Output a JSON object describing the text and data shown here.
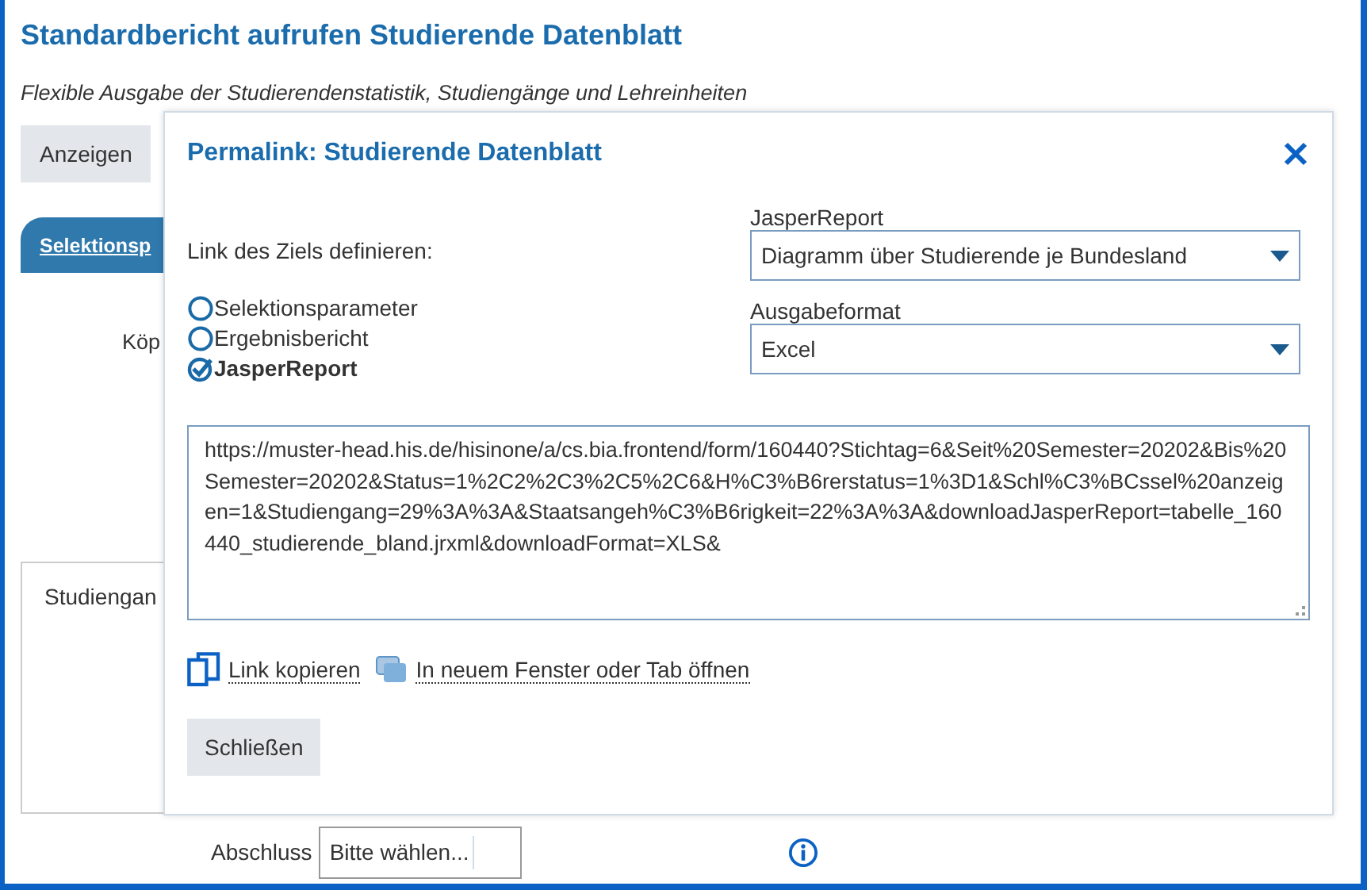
{
  "page": {
    "title": "Standardbericht aufrufen Studierende Datenblatt",
    "subtitle": "Flexible Ausgabe der Studierendenstatistik, Studiengänge und Lehreinheiten",
    "buttons": [
      "Anzeigen"
    ],
    "tab": {
      "label": "Selektionsp",
      "selected": true
    },
    "field_label": "Köp",
    "panel_label": "Studiengan",
    "filter": {
      "label": "Abschluss",
      "value": "Bitte wählen..."
    }
  },
  "dialog": {
    "title": "Permalink: Studierende Datenblatt",
    "target_label": "Link des Ziels definieren:",
    "targets": [
      {
        "label": "Selektionsparameter",
        "selected": false
      },
      {
        "label": "Ergebnisbericht",
        "selected": false
      },
      {
        "label": "JasperReport",
        "selected": true
      }
    ],
    "selects": [
      {
        "label": "JasperReport",
        "value": "Diagramm über Studierende je Bundesland"
      },
      {
        "label": "Ausgabeformat",
        "value": "Excel"
      }
    ],
    "link": "https://muster-head.his.de/hisinone/a/cs.bia.frontend/form/160440?Stichtag=6&Seit%20Semester=20202&Bis%20Semester=20202&Status=1%2C2%2C3%2C5%2C6&H%C3%B6rerstatus=1%3D1&Schl%C3%BCssel%20anzeigen=1&Studiengang=29%3A%3A&Staatsangeh%C3%B6rigkeit=22%3A%3A&downloadJasperReport=tabelle_160440_studierende_bland.jrxml&downloadFormat=XLS&",
    "actions": [
      {
        "kind": "copy",
        "label": "Link kopieren"
      },
      {
        "kind": "window",
        "label": "In neuem Fenster oder Tab öffnen"
      }
    ],
    "close_button": "Schließen"
  }
}
